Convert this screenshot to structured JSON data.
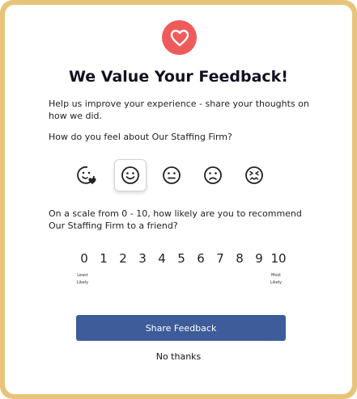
{
  "modal": {
    "title": "We Value Your Feedback!",
    "intro": "Help us improve your experience - share your thoughts on how we did.",
    "question_feel": "How do you feel about Our Staffing Firm?",
    "question_recommend": "On a scale from 0 - 10, how likely are you to recommend Our Staffing Firm to a friend?",
    "scale": [
      "0",
      "1",
      "2",
      "3",
      "4",
      "5",
      "6",
      "7",
      "8",
      "9",
      "10"
    ],
    "scale_low_label": "Least Likely",
    "scale_high_label": "Most Likely",
    "share_button": "Share Feedback",
    "no_thanks": "No thanks"
  },
  "faces": [
    {
      "name": "love-face-icon",
      "selected": false
    },
    {
      "name": "smile-face-icon",
      "selected": true
    },
    {
      "name": "neutral-face-icon",
      "selected": false
    },
    {
      "name": "sad-face-icon",
      "selected": false
    },
    {
      "name": "angry-face-icon",
      "selected": false
    }
  ],
  "colors": {
    "frame": "#e8c47a",
    "heart_badge": "#ef5b5b",
    "button": "#3d5c99"
  }
}
